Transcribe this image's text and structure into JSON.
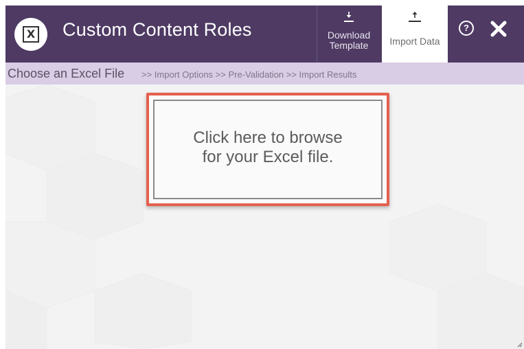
{
  "window": {
    "title": "Custom Content Roles",
    "logo_letter": "X"
  },
  "toolbar": {
    "download_line1": "Download",
    "download_line2": "Template",
    "import_label": "Import Data",
    "help_label": "?",
    "icons": [
      "excel-logo-icon",
      "download-icon",
      "upload-icon",
      "help-icon",
      "close-icon"
    ]
  },
  "breadcrumb": {
    "current": "Choose an Excel File",
    "rest": ">> Import Options >> Pre-Validation >> Import Results"
  },
  "dropzone": {
    "line1": "Click here to browse",
    "line2": "for your Excel file."
  },
  "colors": {
    "header": "#4e3a63",
    "breadcrumb_bar": "#d9cce5",
    "highlight": "#e4604f"
  }
}
